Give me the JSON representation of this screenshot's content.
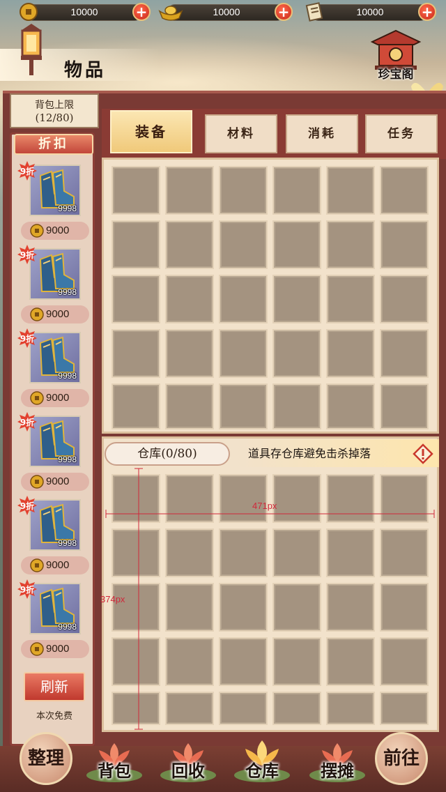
{
  "currency": [
    {
      "name": "copper-coin",
      "value": "10000"
    },
    {
      "name": "gold-ingot",
      "value": "10000"
    },
    {
      "name": "scroll-token",
      "value": "10000"
    }
  ],
  "header": {
    "title": "物品",
    "shop_label": "珍宝阁"
  },
  "left_panel": {
    "bag_limit_label": "背包上限",
    "bag_limit_value": "(12/80)",
    "discount_title": "折扣",
    "items": [
      {
        "tag": "9折",
        "qty": "9998",
        "price": "9000"
      },
      {
        "tag": "9折",
        "qty": "9998",
        "price": "9000"
      },
      {
        "tag": "9折",
        "qty": "9998",
        "price": "9000"
      },
      {
        "tag": "9折",
        "qty": "9998",
        "price": "9000"
      },
      {
        "tag": "9折",
        "qty": "9998",
        "price": "9000"
      },
      {
        "tag": "9折",
        "qty": "9998",
        "price": "9000"
      }
    ],
    "refresh_label": "刷新",
    "refresh_note": "本次免费"
  },
  "tabs": [
    {
      "label": "装备",
      "active": true
    },
    {
      "label": "材料",
      "active": false
    },
    {
      "label": "消耗",
      "active": false
    },
    {
      "label": "任务",
      "active": false
    }
  ],
  "warehouse": {
    "label": "仓库(0/80)",
    "tip": "道具存仓库避免击杀掉落",
    "width_measure": "471px",
    "height_measure": "374px"
  },
  "bottom_nav": {
    "sort": "整理",
    "bag": "背包",
    "recycle": "回收",
    "warehouse": "仓库",
    "stall": "摆摊",
    "go": "前往"
  },
  "colors": {
    "accent_red": "#c2463a",
    "panel_border": "#7a3a34",
    "slot": "#a49380"
  }
}
